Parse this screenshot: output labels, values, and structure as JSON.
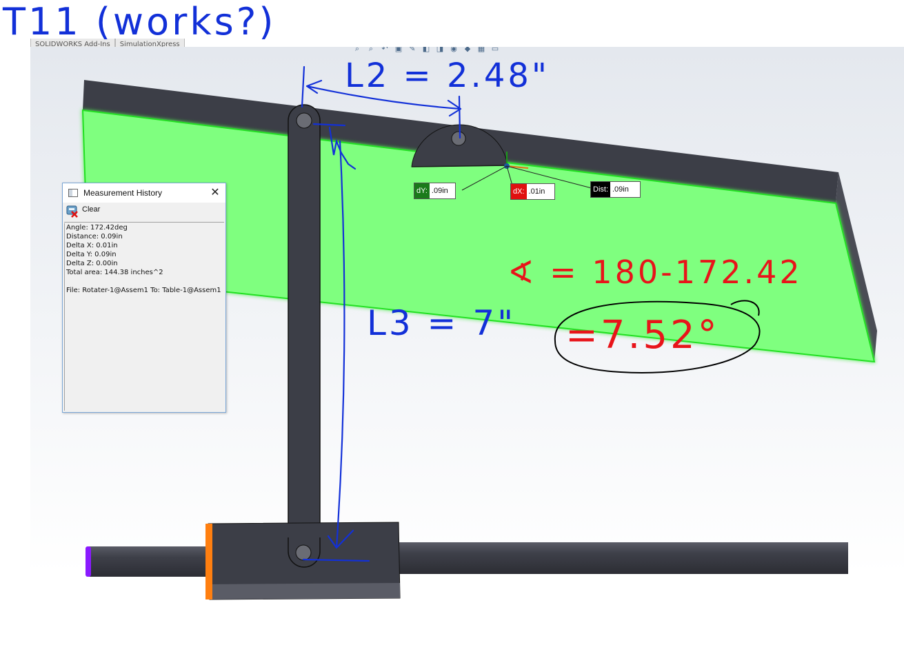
{
  "handwritten": {
    "title": "T11 (works?)",
    "l2": "L2 = 2.48\"",
    "l3": "L3 = 7\"",
    "angle_eq": "∢ = 180-172.42",
    "angle_result": "=7.52°",
    "ink_blue": "#1230d8",
    "ink_red": "#e8141a"
  },
  "top_tabs": [
    "SOLIDWORKS Add-Ins",
    "SimulationXpress"
  ],
  "view_toolbar_icons": [
    "zoom-fit-icon",
    "zoom-area-icon",
    "previous-view-icon",
    "section-view-icon",
    "dynamic-annotation-icon",
    "view-orientation-icon",
    "display-style-icon",
    "hide-show-icon",
    "edit-appearance-icon",
    "apply-scene-icon",
    "view-settings-icon"
  ],
  "measurement_history": {
    "title": "Measurement History",
    "clear_label": "Clear",
    "lines": [
      "Angle: 172.42deg",
      "Distance: 0.09in",
      "Delta X: 0.01in",
      "Delta Y: 0.09in",
      "Delta Z: 0.00in",
      "Total area: 144.38 inches^2",
      "",
      "File: Rotater-1@Assem1 To: Table-1@Assem1"
    ]
  },
  "callouts": {
    "dy": {
      "tag": "dY:",
      "value": ".09in",
      "color": "#1a7a1a"
    },
    "dx": {
      "tag": "dX:",
      "value": ".01in",
      "color": "#e01010"
    },
    "dist": {
      "tag": "Dist:",
      "value": ".09in",
      "color": "#000000"
    }
  },
  "colors": {
    "table_face": "#7fff7f",
    "highlight_edge": "#22e022",
    "part_dark": "#3c3e47",
    "collar_orange": "#ff7f10",
    "end_purple": "#8a1aff"
  }
}
